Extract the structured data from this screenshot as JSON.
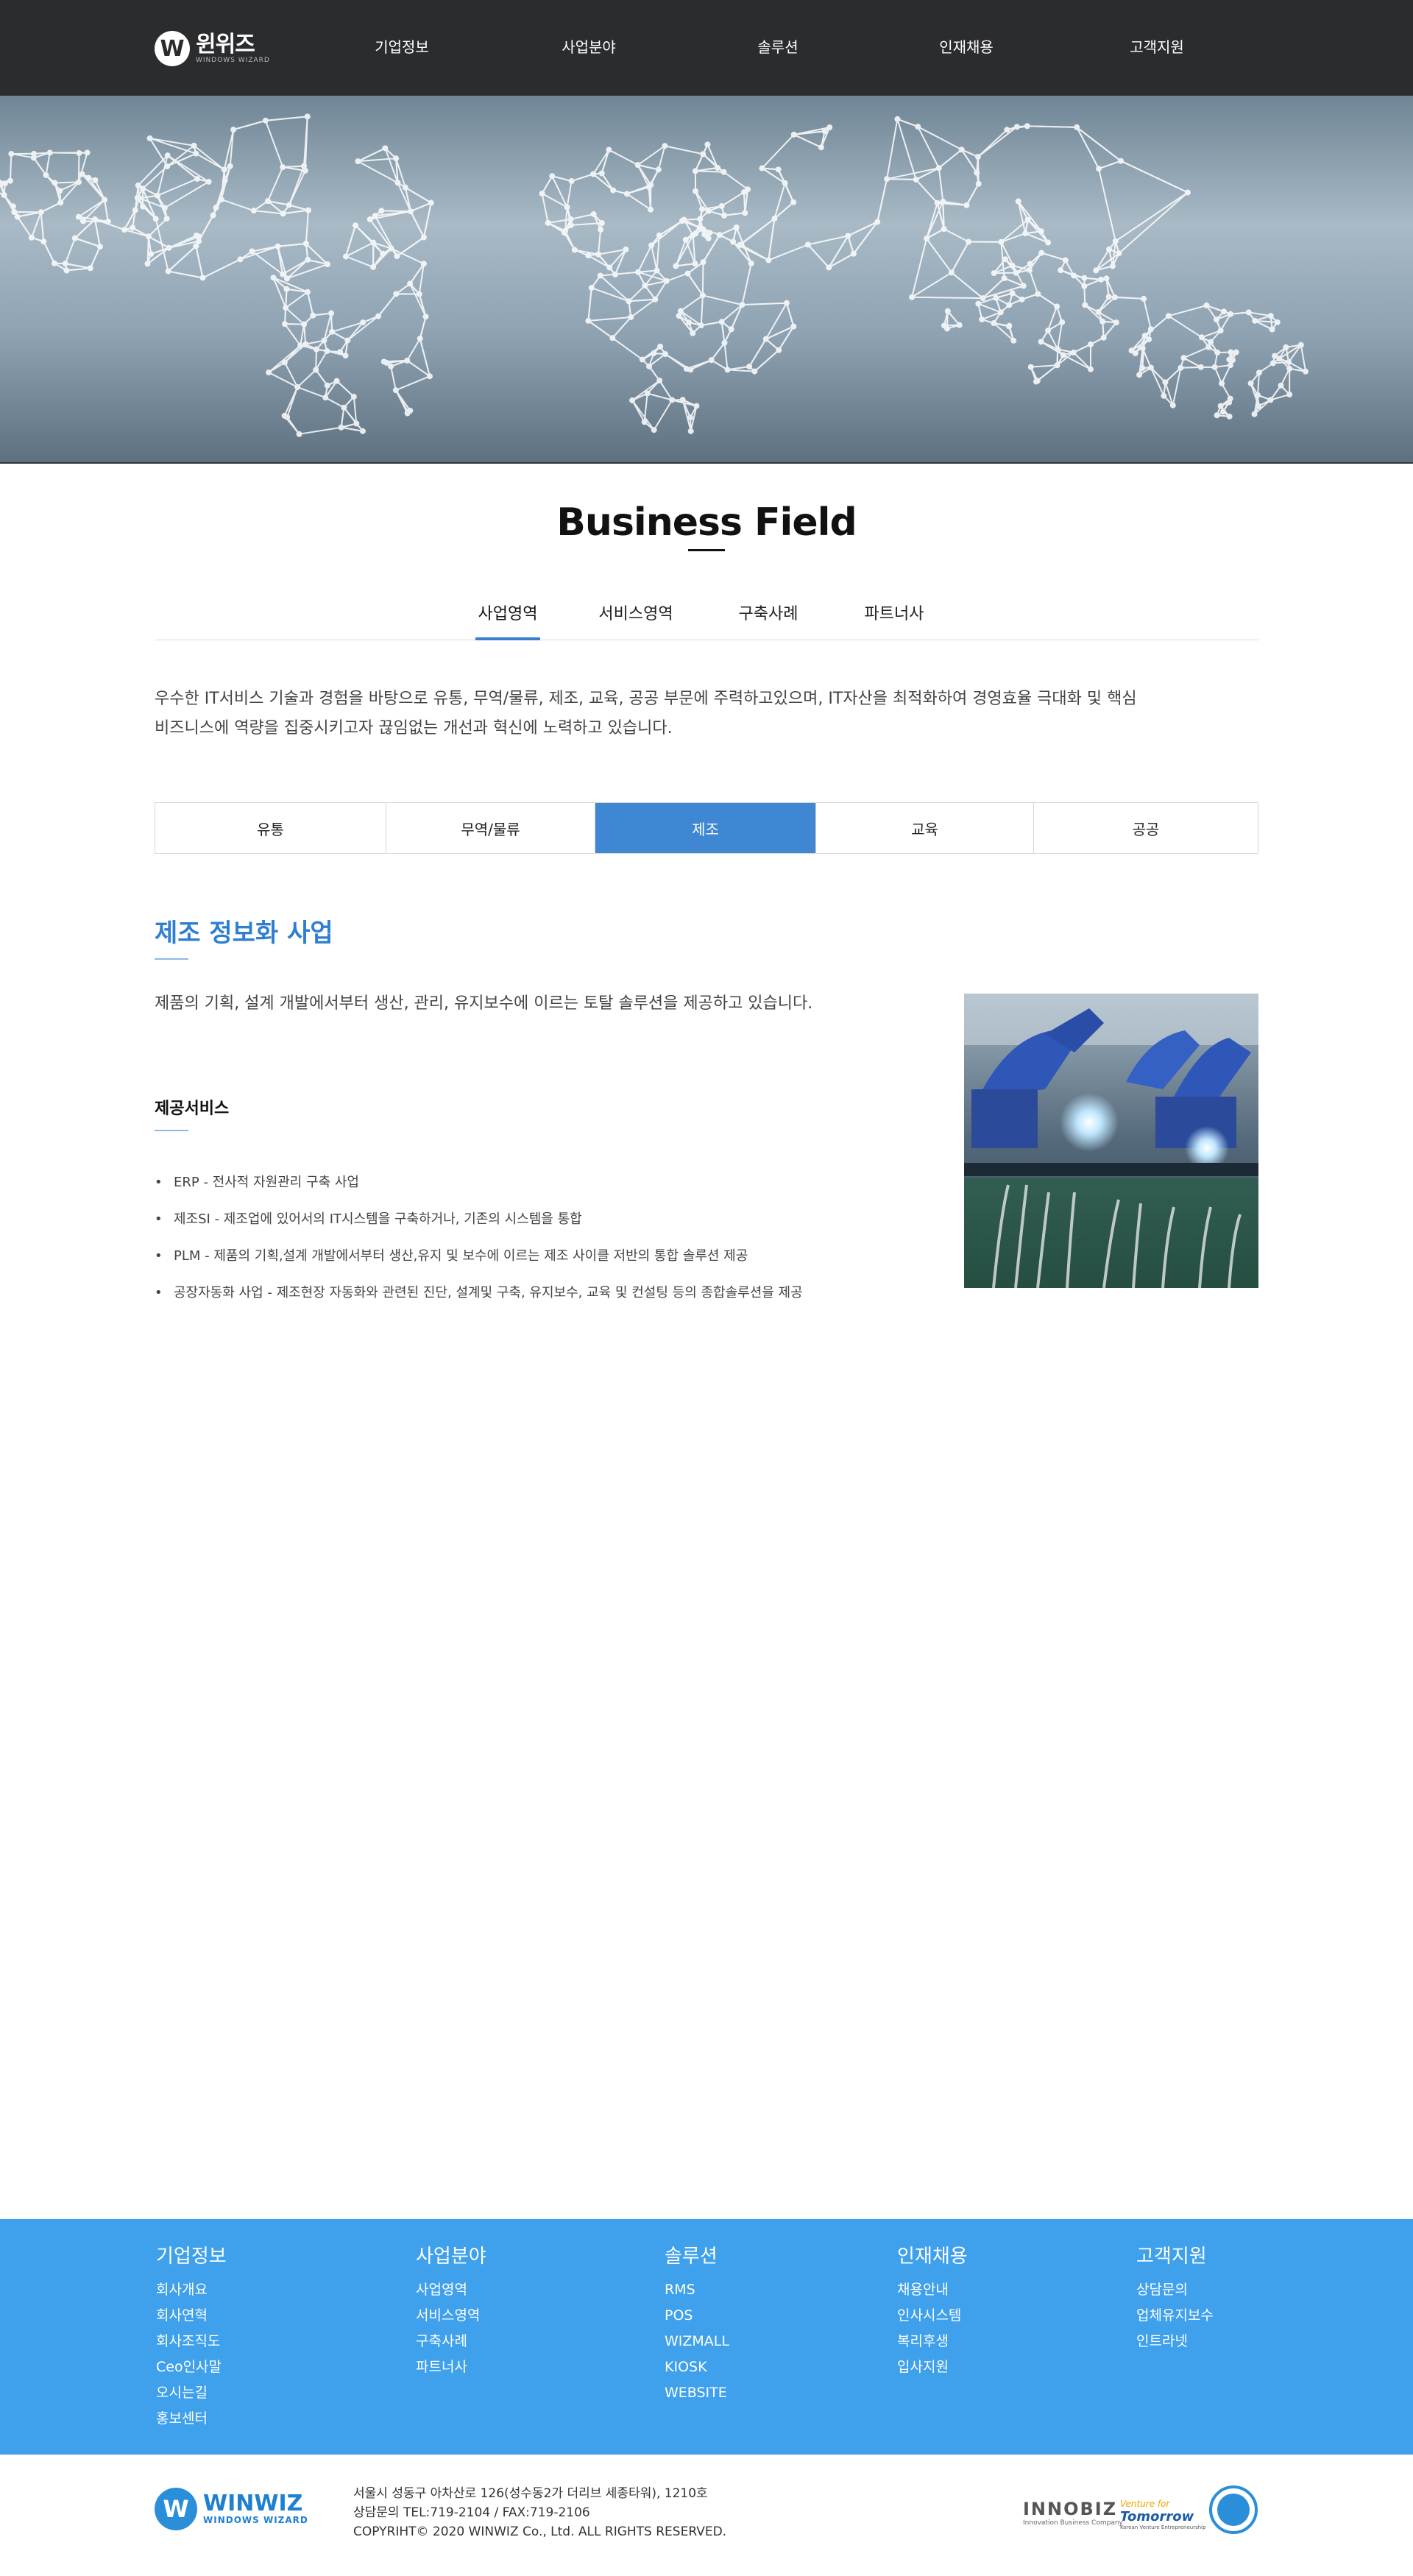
{
  "header": {
    "logo_text": "윈위즈",
    "logo_sub": "WINDOWS WIZARD",
    "logo_letter": "W",
    "nav": [
      "기업정보",
      "사업분야",
      "솔루션",
      "인재채용",
      "고객지원"
    ]
  },
  "page": {
    "title": "Business Field",
    "subtabs": [
      "사업영역",
      "서비스영역",
      "구축사례",
      "파트너사"
    ],
    "active_subtab": "사업영역",
    "intro_line1": "우수한 IT서비스 기술과 경험을 바탕으로 유통, 무역/물류, 제조, 교육, 공공 부문에 주력하고있으며, IT자산을 최적화하여 경영효율 극대화 및 핵심",
    "intro_line2": "비즈니스에 역량을 집중시키고자 끊임없는 개선과 혁신에 노력하고 있습니다."
  },
  "categories": {
    "tabs": [
      "유통",
      "무역/물류",
      "제조",
      "교육",
      "공공"
    ],
    "active": "제조"
  },
  "section": {
    "title": "제조 정보화 사업",
    "description": "제품의 기획, 설계 개발에서부터 생산, 관리, 유지보수에 이르는 토탈 솔루션을 제공하고 있습니다.",
    "services_title": "제공서비스",
    "services": [
      "ERP - 전사적 자원관리 구축 사업",
      "제조SI - 제조업에 있어서의 IT시스템을 구축하거나, 기존의 시스템을 통합",
      "PLM - 제품의 기획,설계 개발에서부터 생산,유지 및 보수에 이르는 제조 사이클 저반의 통합 솔루션 제공",
      "공장자동화 사업 - 제조현장 자동화와 관련된 진단, 설계및 구축, 유지보수, 교육 및 컨설팅 등의 종합솔루션을 제공"
    ]
  },
  "footer": {
    "columns": [
      {
        "head": "기업정보",
        "items": [
          "회사개요",
          "회사연혁",
          "회사조직도",
          "Ceo인사말",
          "오시는길",
          "홍보센터"
        ]
      },
      {
        "head": "사업분야",
        "items": [
          "사업영역",
          "서비스영역",
          "구축사례",
          "파트너사"
        ]
      },
      {
        "head": "솔루션",
        "items": [
          "RMS",
          "POS",
          "WIZMALL",
          "KIOSK",
          "WEBSITE"
        ]
      },
      {
        "head": "인재채용",
        "items": [
          "채용안내",
          "인사시스템",
          "복리후생",
          "입사지원"
        ]
      },
      {
        "head": "고객지원",
        "items": [
          "상담문의",
          "업체유지보수",
          "인트라넷"
        ]
      }
    ],
    "logo_name": "WINWIZ",
    "logo_sub": "WINDOWS WIZARD",
    "address": "서울시 성동구 아차산로 126(성수동2가 더리브 세종타워), 1210호",
    "contact": "상담문의 TEL:719-2104 / FAX:719-2106",
    "copyright": "COPYRIHT© 2020 WINWIZ Co., Ltd. ALL RIGHTS RESERVED.",
    "innobiz": "INNOBIZ",
    "innobiz_sub": "Innovation Business Company",
    "venture_a": "Venture for",
    "venture_b": "Tomorrow",
    "venture_c": "Korean Venture Entrepreneurship"
  },
  "colors": {
    "header_bg": "#2b2c2e",
    "accent_blue": "#3f87d3",
    "footer_blue": "#3fa0ec"
  }
}
